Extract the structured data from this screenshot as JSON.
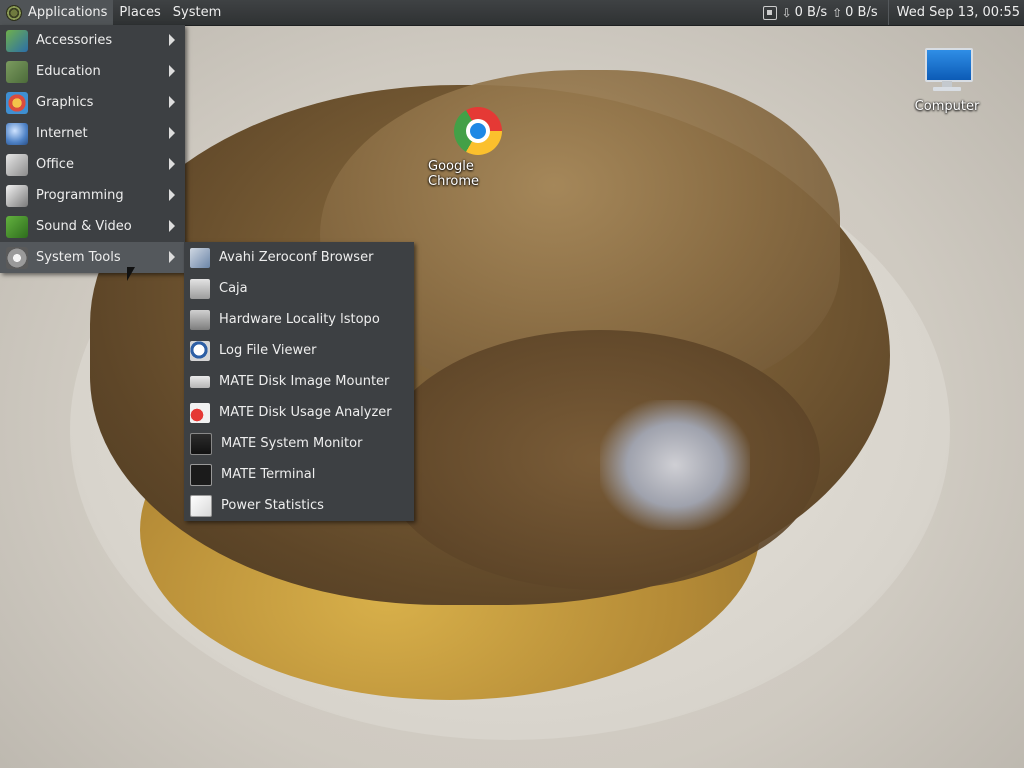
{
  "top_panel": {
    "menus": [
      "Applications",
      "Places",
      "System"
    ],
    "net_download": "0 B/s",
    "net_upload": "0 B/s",
    "clock": "Wed Sep 13, 00:55"
  },
  "desktop_icons": {
    "chrome": "Google Chrome",
    "computer": "Computer"
  },
  "applications_menu": {
    "items": [
      "Accessories",
      "Education",
      "Graphics",
      "Internet",
      "Office",
      "Programming",
      "Sound & Video",
      "System Tools"
    ],
    "highlighted": "System Tools"
  },
  "system_tools_submenu": {
    "items": [
      "Avahi Zeroconf Browser",
      "Caja",
      "Hardware Locality lstopo",
      "Log File Viewer",
      "MATE Disk Image Mounter",
      "MATE Disk Usage Analyzer",
      "MATE System Monitor",
      "MATE Terminal",
      "Power Statistics"
    ]
  }
}
